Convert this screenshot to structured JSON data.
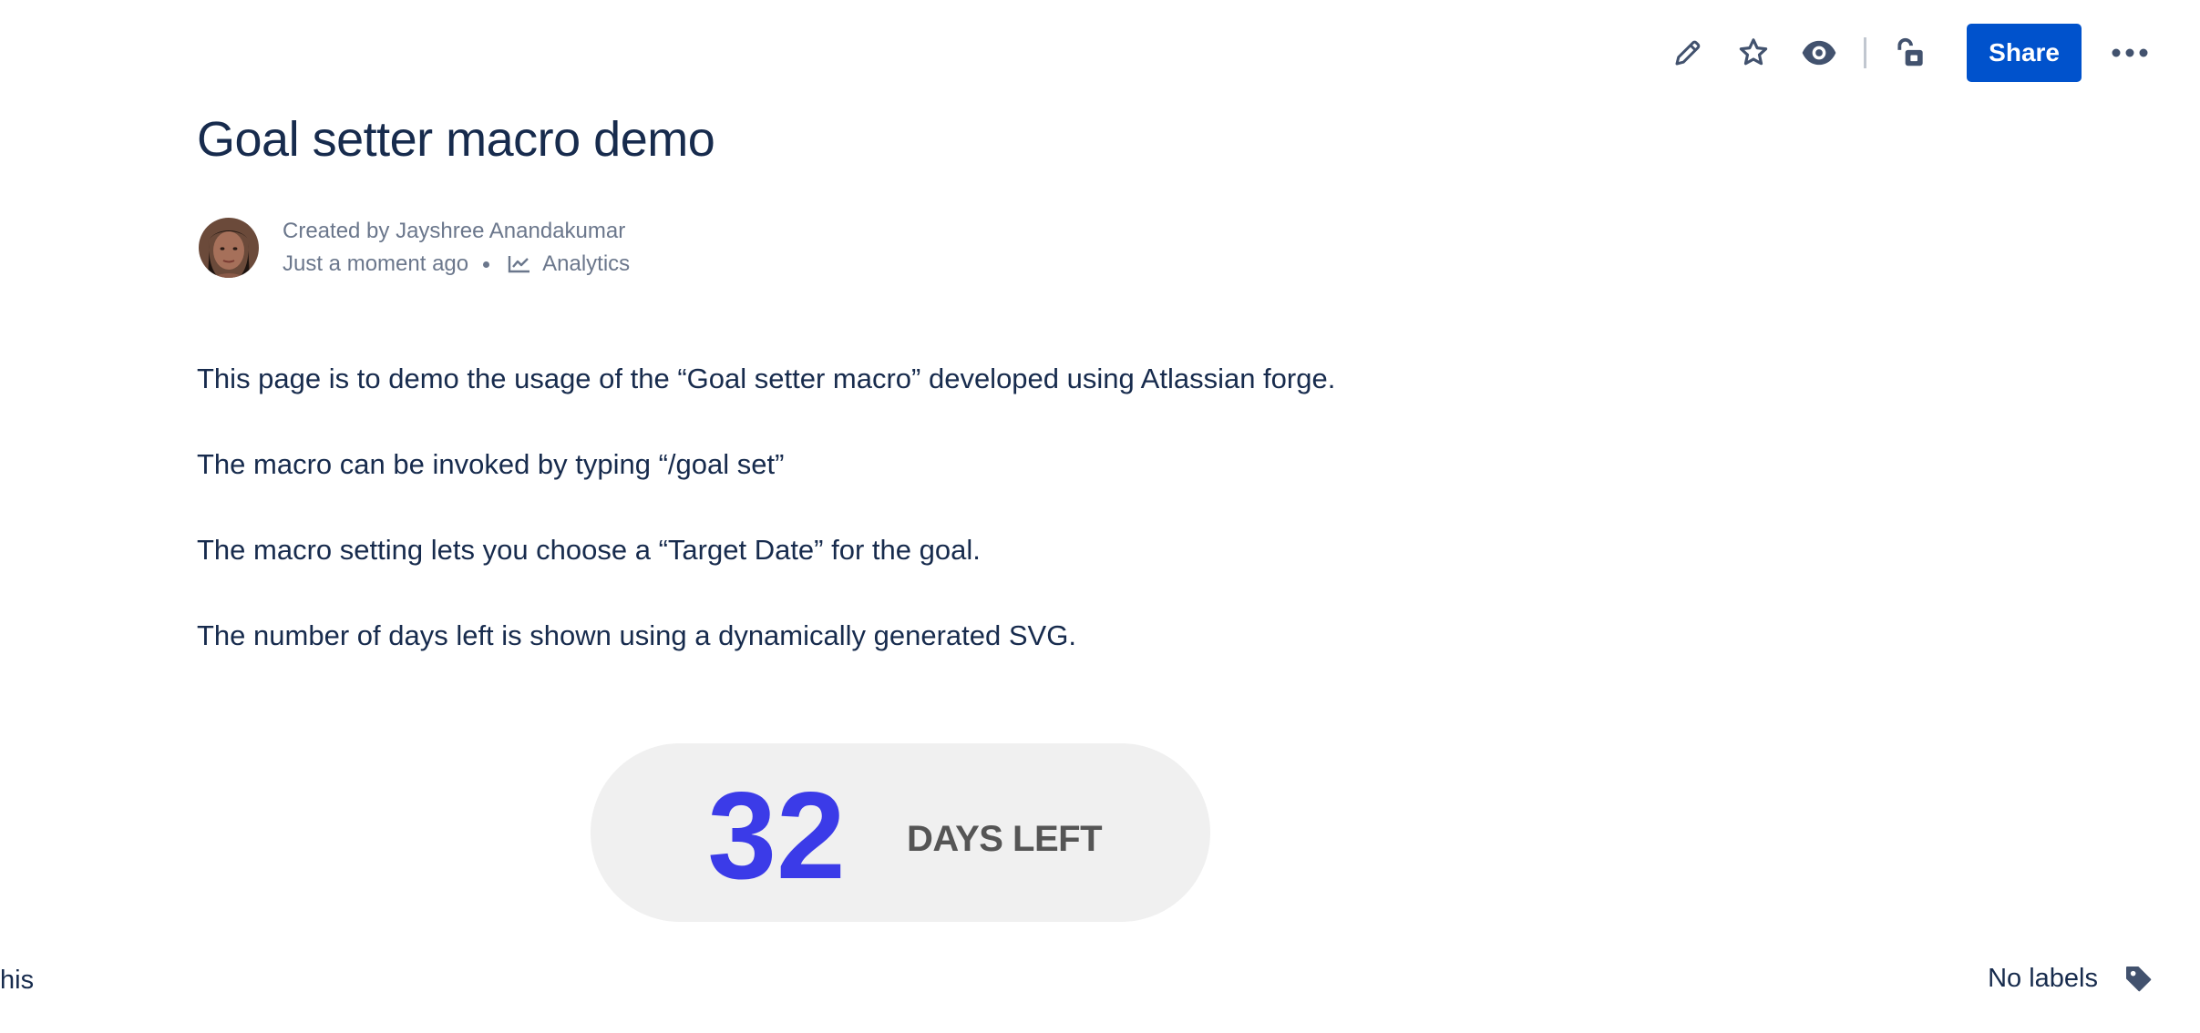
{
  "toolbar": {
    "edit_icon": "pencil-icon",
    "star_icon": "star-icon",
    "watch_icon": "eye-icon",
    "restrictions_icon": "unlock-icon",
    "share_label": "Share",
    "more_icon": "more-horizontal-icon"
  },
  "page": {
    "title": "Goal setter macro demo"
  },
  "byline": {
    "created_by": "Created by Jayshree Anandakumar",
    "timestamp": "Just a moment ago",
    "analytics_label": "Analytics"
  },
  "content": {
    "paragraphs": [
      "This page is to demo the usage of the “Goal setter macro” developed using Atlassian forge.",
      "The macro can be invoked by typing “/goal set”",
      "The macro setting lets you choose a “Target Date” for the goal.",
      "The number of days left is shown using a dynamically generated SVG."
    ]
  },
  "goal_widget": {
    "days": "32",
    "label": "DAYS LEFT"
  },
  "footer": {
    "left_text": "his",
    "labels_text": "No labels"
  },
  "colors": {
    "share_button": "#0052cc",
    "text_primary": "#172b4d",
    "text_secondary": "#6b778c",
    "icon": "#42526e",
    "widget_bg": "#f0f0f0",
    "days_number": "#3b3be8",
    "days_label": "#555555"
  }
}
